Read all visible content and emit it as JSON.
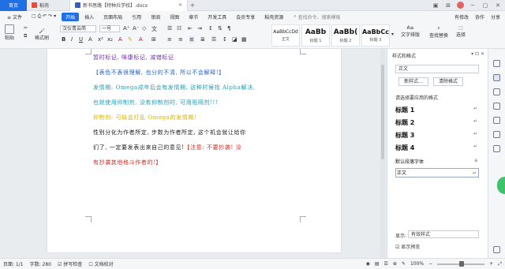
{
  "tabs": {
    "home": "首页",
    "other": "稻壳",
    "doc": "新书思路【特种兵学校】.docx",
    "add": "+"
  },
  "menu": {
    "items": [
      "开始",
      "插入",
      "页面布局",
      "引用",
      "审阅",
      "视图",
      "章节",
      "开发工具",
      "会员专享",
      "稻壳资源"
    ],
    "search_placeholder": "查找命令、搜索模板",
    "right": [
      "有修改",
      "协作",
      "分享"
    ],
    "file_label": "文件"
  },
  "toolbar": {
    "paste": "粘贴",
    "format_painter": "格式刷",
    "font": "汉仪青云简",
    "size": "一号",
    "styles": [
      {
        "big": "AaBbCcDd",
        "cap": "正文"
      },
      {
        "big": "AaBb",
        "cap": "标题 1"
      },
      {
        "big": "AaBb(",
        "cap": "标题 2"
      },
      {
        "big": "AaBbCc",
        "cap": "标题 3"
      }
    ],
    "text_tools": "文字排版",
    "find_replace": "查找替换",
    "select": "选择"
  },
  "document": {
    "lines": [
      {
        "text": "暂时标记, 咪康标记, 减错标记",
        "color": "purple"
      },
      {
        "text": "【表色不表很理解, 也分的不清, 所以不会解释!】",
        "color": "blue"
      },
      {
        "text": "发情期: Omega成年后会有发情期, 这种时候找 Alpha解决,",
        "color": "teal"
      },
      {
        "text": "也就使用抑制剂, 没有抑制剂时, 可用阻隔剂!!!",
        "color": "teal"
      },
      {
        "text": "抑制剂: 可缺会打乱 Omega的发情期!",
        "color": "yellow"
      },
      {
        "text": "性别分化为作者所定, 步数为作者所定, 这个机会就让给你",
        "color": "black"
      },
      {
        "text": "们了, 一定要发表出来自己的意见!",
        "color": "black",
        "tail": "【注意: 不要抄袭! 没",
        "tail_color": "red"
      },
      {
        "text": "有抄袭其他格斗作者的!】",
        "color": "red"
      }
    ]
  },
  "panel": {
    "title": "样式和格式",
    "current_style": "正文",
    "new_style": "新样式...",
    "clear_format": "清除格式",
    "apply_label": "请选择要应用的格式",
    "styles": [
      "标题 1",
      "标题 2",
      "标题 3",
      "标题 4"
    ],
    "default_font": "默认段落字体",
    "body": "正文",
    "show_label": "显示:",
    "show_value": "有效样式",
    "preview": "显示预览"
  },
  "status": {
    "page": "页面: 1/1",
    "words": "字数: 280",
    "spell": "拼写检查",
    "proof": "文档校对",
    "zoom": "100%",
    "zoom_value": 0.5
  },
  "colors": {
    "purple": "#6f2cb0",
    "blue": "#2b62c4",
    "teal": "#1d9fb6",
    "yellow": "#d7b400",
    "black": "#222222",
    "red": "#e0251b",
    "accent": "#1f6fe5"
  }
}
